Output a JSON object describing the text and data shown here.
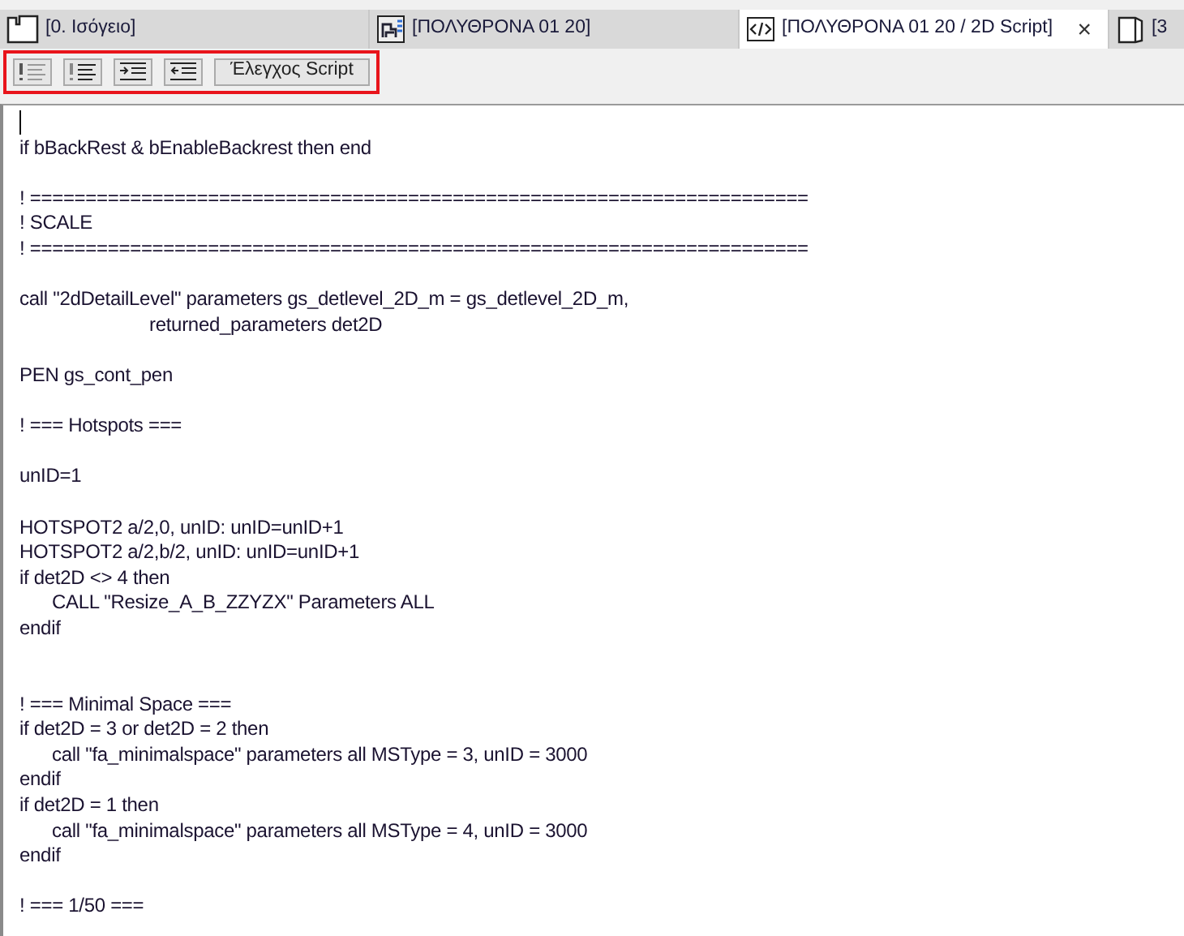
{
  "tabs": [
    {
      "label": "[0. Ισόγειο]",
      "selected": false
    },
    {
      "label": "[ΠΟΛΥΘΡΟΝΑ 01 20]",
      "selected": false
    },
    {
      "label": "[ΠΟΛΥΘΡΟΝΑ 01 20 / 2D Script]",
      "selected": true,
      "close": "×"
    },
    {
      "label": "[3",
      "selected": false
    }
  ],
  "toolbar": {
    "highlighted": true,
    "buttons": [
      {
        "kind": "icon"
      },
      {
        "kind": "icon"
      },
      {
        "kind": "icon"
      },
      {
        "kind": "icon"
      },
      {
        "kind": "text",
        "label": "Έλεγχος Script"
      }
    ]
  },
  "editor": {
    "cursor": true,
    "lines": [
      {
        "kind": "blank"
      },
      {
        "kind": "code",
        "text": "if bBackRest & bEnableBackrest then end"
      },
      {
        "kind": "blank"
      },
      {
        "kind": "code",
        "text": "! ======================================================================"
      },
      {
        "kind": "code",
        "text": "! SCALE"
      },
      {
        "kind": "code",
        "text": "! ======================================================================"
      },
      {
        "kind": "blank"
      },
      {
        "kind": "code",
        "text": "call \"2dDetailLevel\" parameters gs_detlevel_2D_m = gs_detlevel_2D_m,"
      },
      {
        "kind": "code",
        "text": "\t\t\t\treturned_parameters det2D"
      },
      {
        "kind": "blank"
      },
      {
        "kind": "code",
        "text": "PEN gs_cont_pen"
      },
      {
        "kind": "blank"
      },
      {
        "kind": "code",
        "text": "! === Hotspots ==="
      },
      {
        "kind": "blank"
      },
      {
        "kind": "code",
        "text": "unID=1"
      },
      {
        "kind": "blank"
      },
      {
        "kind": "code",
        "text": "HOTSPOT2 a/2,0, unID: unID=unID+1"
      },
      {
        "kind": "code",
        "text": "HOTSPOT2 a/2,b/2, unID: unID=unID+1"
      },
      {
        "kind": "code",
        "text": "if det2D <> 4 then"
      },
      {
        "kind": "code",
        "text": "\tCALL \"Resize_A_B_ZZYZX\" Parameters ALL"
      },
      {
        "kind": "code",
        "text": "endif"
      },
      {
        "kind": "blank"
      },
      {
        "kind": "blank"
      },
      {
        "kind": "code",
        "text": "! === Minimal Space ==="
      },
      {
        "kind": "code",
        "text": "if det2D = 3 or det2D = 2 then"
      },
      {
        "kind": "code",
        "text": "\tcall \"fa_minimalspace\" parameters all MSType = 3, unID = 3000"
      },
      {
        "kind": "code",
        "text": "endif"
      },
      {
        "kind": "code",
        "text": "if det2D = 1 then"
      },
      {
        "kind": "code",
        "text": "\tcall \"fa_minimalspace\" parameters all MSType = 4, unID = 3000"
      },
      {
        "kind": "code",
        "text": "endif"
      },
      {
        "kind": "blank"
      },
      {
        "kind": "code",
        "text": "! === 1/50 ==="
      }
    ]
  }
}
